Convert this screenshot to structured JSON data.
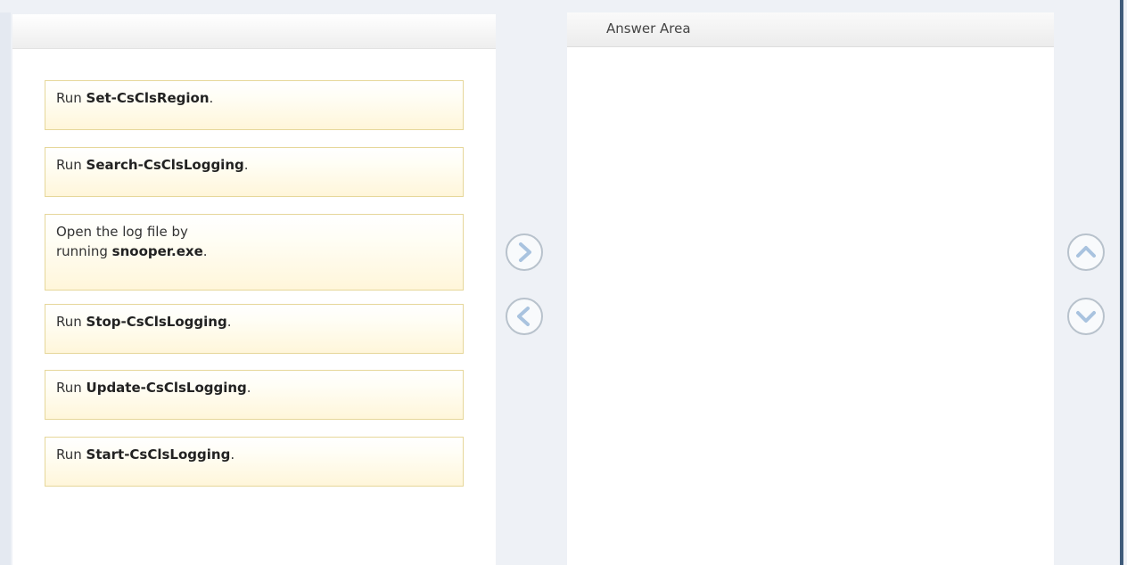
{
  "answer_area": {
    "title": "Answer Area"
  },
  "items": [
    {
      "prefix": "Run ",
      "command": "Set-CsClsRegion",
      "suffix": "."
    },
    {
      "prefix": "Run ",
      "command": "Search-CsClsLogging",
      "suffix": "."
    },
    {
      "line1": "Open the log file by",
      "prefix": "running ",
      "command": "snooper.exe",
      "suffix": "."
    },
    {
      "prefix": "Run ",
      "command": "Stop-CsClsLogging",
      "suffix": "."
    },
    {
      "prefix": "Run ",
      "command": "Update-CsClsLogging",
      "suffix": "."
    },
    {
      "prefix": "Run ",
      "command": "Start-CsClsLogging",
      "suffix": "."
    }
  ],
  "icons": {
    "move_right": "chevron-right-icon",
    "move_left": "chevron-left-icon",
    "move_up": "chevron-up-icon",
    "move_down": "chevron-down-icon"
  },
  "colors": {
    "item_fill": "#fff6da",
    "item_border": "#e6d79a",
    "button_border": "#b8c2cc",
    "button_icon": "#a9c3df"
  }
}
